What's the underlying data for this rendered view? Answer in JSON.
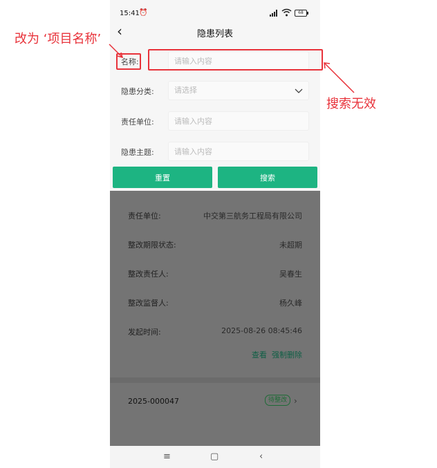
{
  "status_bar": {
    "time": "15:41",
    "battery": "68"
  },
  "nav": {
    "title": "隐患列表"
  },
  "form": {
    "name": {
      "label": "名称:",
      "placeholder": "请输入内容"
    },
    "category": {
      "label": "隐患分类:",
      "placeholder": "请选择"
    },
    "unit": {
      "label": "责任单位:",
      "placeholder": "请输入内容"
    },
    "topic": {
      "label": "隐患主题:",
      "placeholder": "请输入内容"
    },
    "reset_label": "重置",
    "search_label": "搜索"
  },
  "record": {
    "rows": [
      {
        "label": "责任单位:",
        "value": "中交第三航务工程局有限公司"
      },
      {
        "label": "整改期限状态:",
        "value": "未超期"
      },
      {
        "label": "整改责任人:",
        "value": "吴春生"
      },
      {
        "label": "整改监督人:",
        "value": "杨久峰"
      },
      {
        "label": "发起时间:",
        "value": "2025-08-26 08:45:46"
      }
    ],
    "view_label": "查看",
    "force_delete_label": "强制删除"
  },
  "next_record": {
    "id": "2025-000047",
    "status": "待整改"
  },
  "annotations": {
    "rename_note": "改为 ‘项目名称’",
    "search_note": "搜索无效",
    "color": "#e8323a"
  }
}
